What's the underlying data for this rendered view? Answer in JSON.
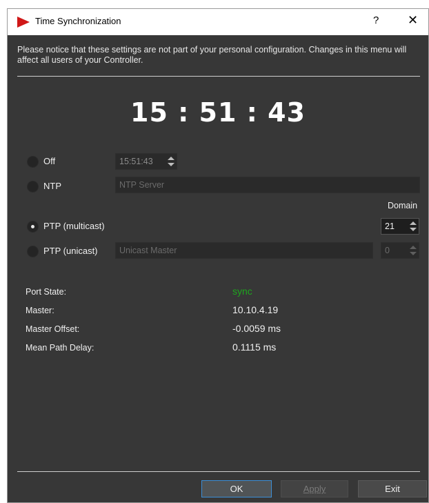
{
  "window": {
    "title": "Time Synchronization",
    "help_label": "?",
    "close_label": "✕"
  },
  "notice": "Please notice that these settings are not part of your personal configuration. Changes in this menu will affect all users of your Controller.",
  "clock": "15 : 51 : 43",
  "modes": {
    "off": {
      "label": "Off",
      "time_value": "15:51:43",
      "selected": false
    },
    "ntp": {
      "label": "NTP",
      "server_placeholder": "NTP Server",
      "selected": false
    },
    "ptp_multicast": {
      "label": "PTP (multicast)",
      "domain_value": "21",
      "selected": true
    },
    "ptp_unicast": {
      "label": "PTP (unicast)",
      "master_placeholder": "Unicast Master",
      "domain_value": "0",
      "selected": false
    }
  },
  "domain_label": "Domain",
  "status": {
    "port_state_label": "Port State:",
    "port_state_value": "sync",
    "master_label": "Master:",
    "master_value": "10.10.4.19",
    "offset_label": "Master Offset:",
    "offset_value": "-0.0059 ms",
    "delay_label": "Mean Path Delay:",
    "delay_value": "0.1115 ms"
  },
  "buttons": {
    "ok": "OK",
    "apply": "Apply",
    "exit": "Exit"
  },
  "colors": {
    "background": "#373737",
    "sync": "#1ea51e",
    "brand_icon": "#d01818",
    "ok_border": "#3d8fd6"
  }
}
